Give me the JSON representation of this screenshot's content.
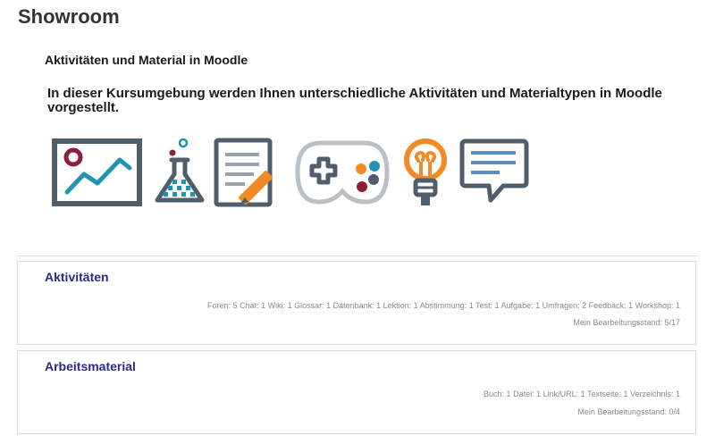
{
  "page": {
    "title": "Showroom",
    "heading": "Aktivitäten und Material in Moodle",
    "intro": "In dieser Kursumgebung werden Ihnen unterschiedliche Aktivitäten und Materialtypen in Moodle vorgestellt."
  },
  "icons": [
    "chart-icon",
    "flask-icon",
    "document-edit-icon",
    "gamepad-icon",
    "lightbulb-icon",
    "speech-bubble-icon"
  ],
  "colors": {
    "slate": "#4f5e6a",
    "crimson": "#8c1f3a",
    "teal": "#1f95b3",
    "orange": "#f28a25",
    "blue": "#5a8cc6",
    "card_title": "#2a2a8a"
  },
  "sections": [
    {
      "title": "Aktivitäten",
      "counts": "Foren: 5  Chat: 1  Wiki: 1  Glossar: 1  Datenbank: 1  Lektion: 1  Abstimmung: 1  Test: 1  Aufgabe: 1  Umfragen: 2  Feedback: 1  Workshop: 1",
      "progress": "Mein Bearbeitungsstand: 5/17"
    },
    {
      "title": "Arbeitsmaterial",
      "counts": "Buch: 1  Datei: 1  Link/URL: 1  Textseite: 1  Verzeichnis: 1",
      "progress": "Mein Bearbeitungsstand: 0/4"
    }
  ]
}
